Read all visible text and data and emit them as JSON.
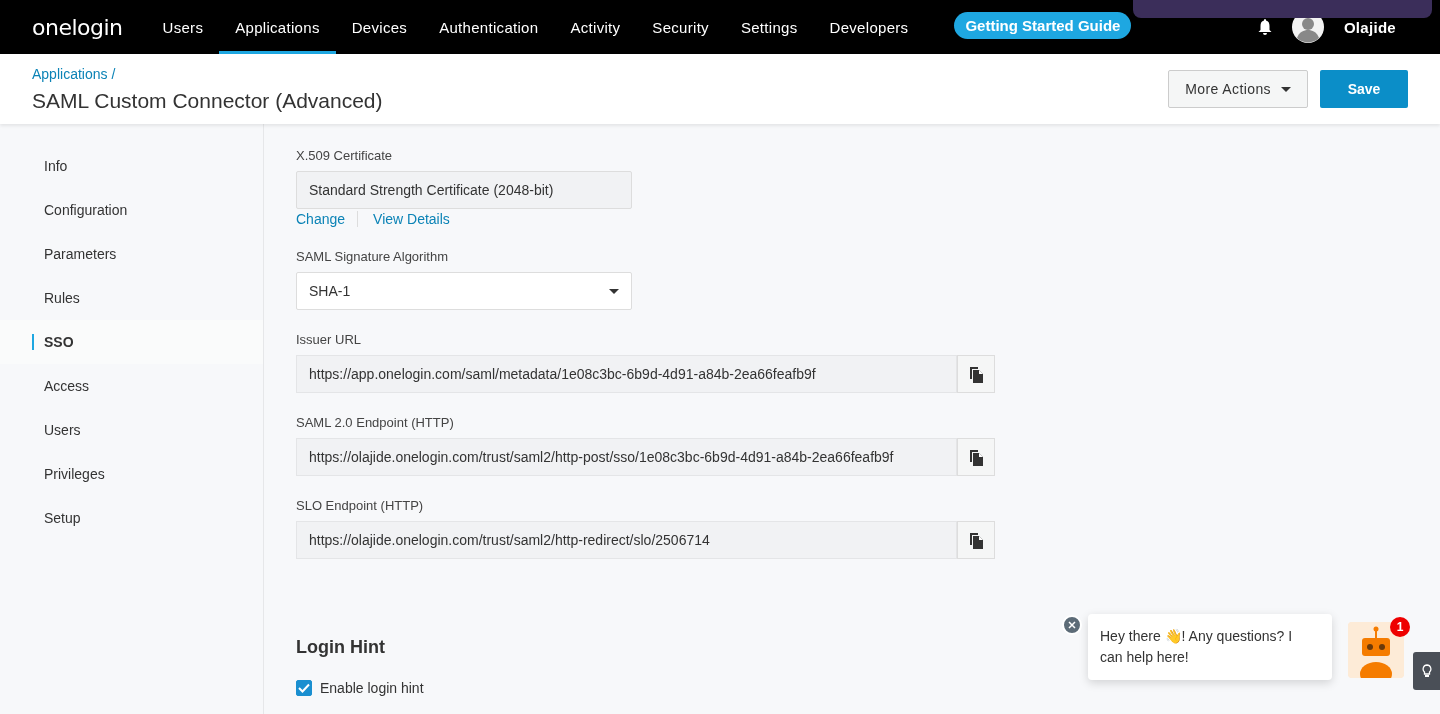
{
  "top_nav": {
    "logo": "onelogin",
    "items": [
      {
        "label": "Users",
        "selected": false
      },
      {
        "label": "Applications",
        "selected": true
      },
      {
        "label": "Devices",
        "selected": false
      },
      {
        "label": "Authentication",
        "selected": false
      },
      {
        "label": "Activity",
        "selected": false
      },
      {
        "label": "Security",
        "selected": false
      },
      {
        "label": "Settings",
        "selected": false
      },
      {
        "label": "Developers",
        "selected": false
      }
    ],
    "guide_button": "Getting Started Guide",
    "user": "Olajide"
  },
  "header": {
    "breadcrumb": "Applications /",
    "title": "SAML Custom Connector (Advanced)",
    "more_actions": "More Actions",
    "save": "Save"
  },
  "sidebar": {
    "items": [
      {
        "label": "Info",
        "selected": false
      },
      {
        "label": "Configuration",
        "selected": false
      },
      {
        "label": "Parameters",
        "selected": false
      },
      {
        "label": "Rules",
        "selected": false
      },
      {
        "label": "SSO",
        "selected": true
      },
      {
        "label": "Access",
        "selected": false
      },
      {
        "label": "Users",
        "selected": false
      },
      {
        "label": "Privileges",
        "selected": false
      },
      {
        "label": "Setup",
        "selected": false
      }
    ]
  },
  "fields": [
    {
      "kind": "readonly",
      "label": "X.509 Certificate",
      "value": "Standard Strength Certificate (2048-bit)",
      "links": [
        "Change",
        "View Details"
      ]
    },
    {
      "kind": "select",
      "label": "SAML Signature Algorithm",
      "value": "SHA-1"
    },
    {
      "kind": "copy",
      "label": "Issuer URL",
      "value": "https://app.onelogin.com/saml/metadata/1e08c3bc-6b9d-4d91-a84b-2ea66feafb9f"
    },
    {
      "kind": "copy",
      "label": "SAML 2.0 Endpoint (HTTP)",
      "value": "https://olajide.onelogin.com/trust/saml2/http-post/sso/1e08c3bc-6b9d-4d91-a84b-2ea66feafb9f"
    },
    {
      "kind": "copy",
      "label": "SLO Endpoint (HTTP)",
      "value": "https://olajide.onelogin.com/trust/saml2/http-redirect/slo/2506714"
    }
  ],
  "login_hint": {
    "title": "Login Hint",
    "option": {
      "label": "Enable login hint",
      "checked": true
    }
  },
  "chat": {
    "message": "Hey there 👋! Any questions? I can help here!",
    "badge": "1"
  }
}
